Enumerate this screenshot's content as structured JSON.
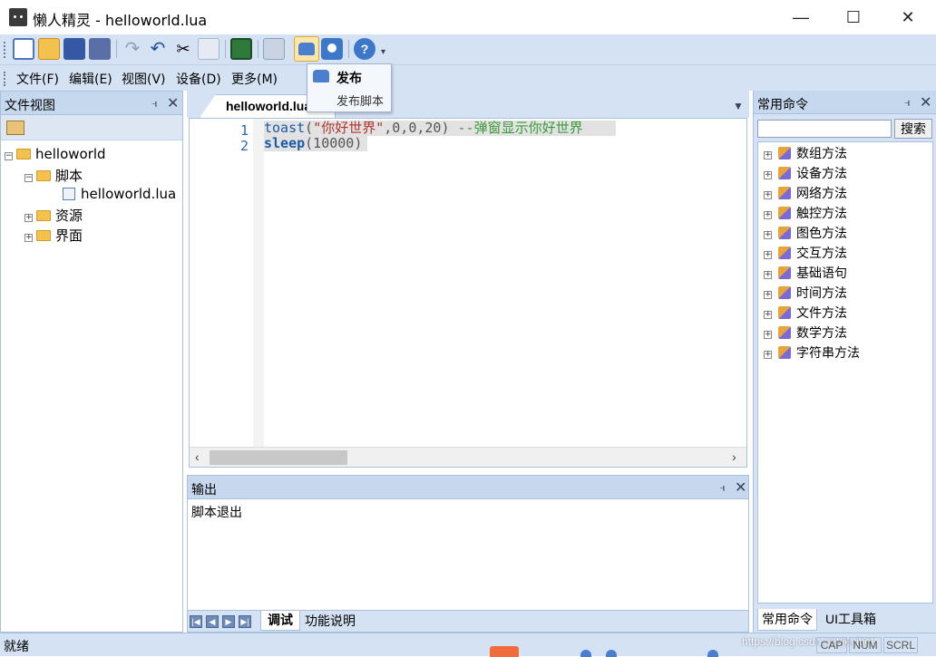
{
  "window": {
    "title": "懒人精灵 - helloworld.lua"
  },
  "menu": [
    "文件(F)",
    "编辑(E)",
    "视图(V)",
    "设备(D)",
    "更多(M)"
  ],
  "popup": {
    "title": "发布",
    "item": "发布脚本"
  },
  "left_panel": {
    "title": "文件视图",
    "tree": {
      "root": "helloworld",
      "script_folder": "脚本",
      "script_file": "helloworld.lua",
      "resources": "资源",
      "ui": "界面"
    }
  },
  "editor": {
    "tab": "helloworld.lua",
    "lines": [
      {
        "num": "1",
        "fn": "toast",
        "open": "(",
        "str": "\"你好世界\"",
        "args": ",0,0,20)",
        "comment": " --弹窗显示你好世界"
      },
      {
        "num": "2",
        "fn": "sleep",
        "args": "(10000)"
      }
    ]
  },
  "output": {
    "title": "输出",
    "content": "脚本退出",
    "tabs": [
      "调试",
      "功能说明"
    ]
  },
  "right_panel": {
    "title": "常用命令",
    "search_button": "搜索",
    "search_value": "",
    "commands": [
      "数组方法",
      "设备方法",
      "网络方法",
      "触控方法",
      "图色方法",
      "交互方法",
      "基础语句",
      "时间方法",
      "文件方法",
      "数学方法",
      "字符串方法"
    ],
    "bottom_tabs": [
      "常用命令",
      "UI工具箱"
    ]
  },
  "status": {
    "text": "就绪",
    "indicators": [
      "CAP",
      "NUM",
      "SCRL"
    ],
    "watermark": "https://blog.csdn.net/jeyibot"
  },
  "colors": {
    "accent": "#d4e2f4",
    "keyword": "#1b5aa8",
    "string": "#b3322d",
    "comment": "#3a9a3a"
  }
}
